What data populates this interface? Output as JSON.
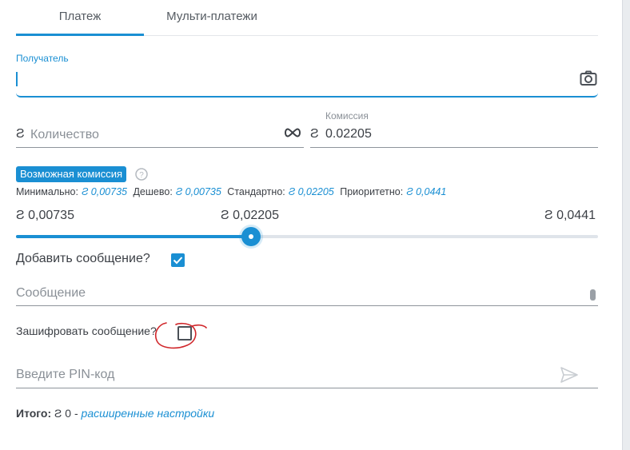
{
  "tabs": [
    {
      "label": "Платеж",
      "active": true
    },
    {
      "label": "Мульти-платежи",
      "active": false
    }
  ],
  "recipient": {
    "label": "Получатель",
    "value": "",
    "icon": "camera-icon"
  },
  "currency_symbol": "Ƨ",
  "amount": {
    "placeholder": "Количество",
    "value": "",
    "icon": "infinity-icon"
  },
  "fee": {
    "label": "Комиссия",
    "value": "0.02205"
  },
  "possible_fee": {
    "badge": "Возможная комиссия",
    "levels": [
      {
        "label": "Минимально:",
        "value": "0,00735"
      },
      {
        "label": "Дешево:",
        "value": "0,00735"
      },
      {
        "label": "Стандартно:",
        "value": "0,02205"
      },
      {
        "label": "Приоритетно:",
        "value": "0,0441"
      }
    ]
  },
  "slider": {
    "min": "0,00735",
    "mid": "0,02205",
    "max": "0,0441",
    "value": 0.02205
  },
  "add_message": {
    "label": "Добавить сообщение?",
    "checked": true
  },
  "message": {
    "placeholder": "Сообщение",
    "value": ""
  },
  "encrypt": {
    "label": "Зашифровать сообщение?",
    "checked": false
  },
  "pin": {
    "placeholder": "Введите PIN-код",
    "value": ""
  },
  "total": {
    "label": "Итого:",
    "value": "0",
    "separator": "-",
    "link": "расширенные настройки"
  },
  "colors": {
    "accent": "#1a8fd3",
    "annotation": "#d0262a"
  }
}
